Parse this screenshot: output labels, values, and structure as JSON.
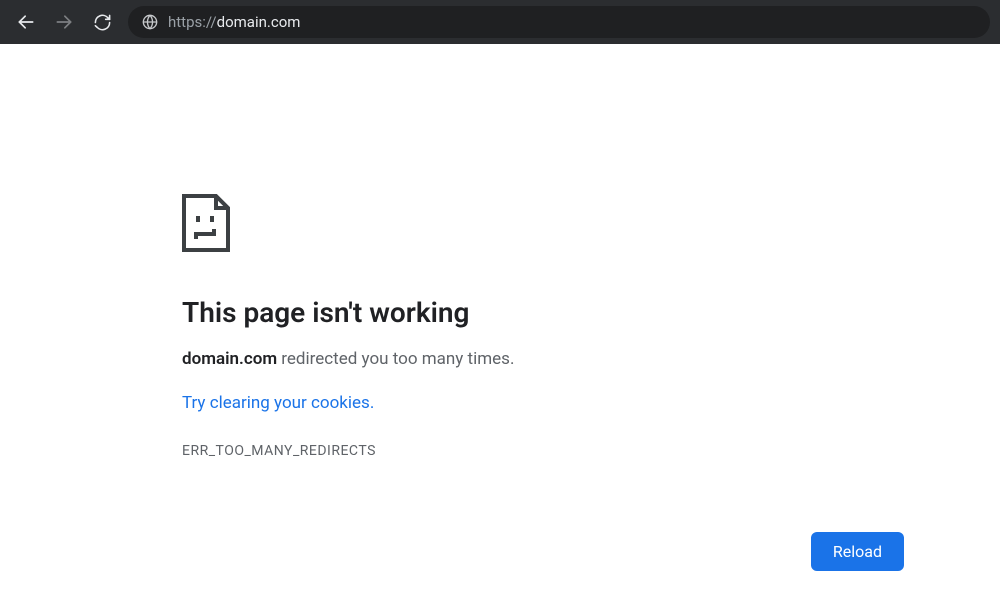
{
  "browser": {
    "url_scheme": "https://",
    "url_host": "domain.com"
  },
  "error": {
    "title": "This page isn't working",
    "domain": "domain.com",
    "redirect_suffix": " redirected you too many times.",
    "cookies_link": "Try clearing your cookies.",
    "code": "ERR_TOO_MANY_REDIRECTS",
    "reload_label": "Reload"
  }
}
